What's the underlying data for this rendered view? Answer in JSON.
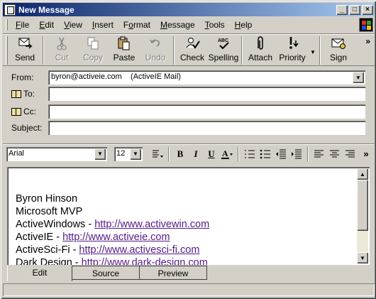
{
  "window": {
    "title": "New Message"
  },
  "menu": [
    {
      "pre": "",
      "u": "F",
      "post": "ile"
    },
    {
      "pre": "",
      "u": "E",
      "post": "dit"
    },
    {
      "pre": "",
      "u": "V",
      "post": "iew"
    },
    {
      "pre": "",
      "u": "I",
      "post": "nsert"
    },
    {
      "pre": "F",
      "u": "o",
      "post": "rmat"
    },
    {
      "pre": "",
      "u": "M",
      "post": "essage"
    },
    {
      "pre": "",
      "u": "T",
      "post": "ools"
    },
    {
      "pre": "",
      "u": "H",
      "post": "elp"
    }
  ],
  "toolbar": {
    "send": "Send",
    "cut": "Cut",
    "copy": "Copy",
    "paste": "Paste",
    "undo": "Undo",
    "check": "Check",
    "spelling": "Spelling",
    "attach": "Attach",
    "priority": "Priority",
    "sign": "Sign",
    "chevron": "»"
  },
  "header": {
    "from_label": "From:",
    "from_value": "byron@activeie.com    (ActiveIE Mail)",
    "to_label": "To:",
    "to_value": "",
    "cc_label": "Cc:",
    "cc_value": "",
    "subject_label": "Subject:",
    "subject_value": ""
  },
  "format": {
    "font": "Arial",
    "size": "12",
    "bold": "B",
    "italic": "I",
    "underline": "U",
    "chevron": "»"
  },
  "body": {
    "lines": [
      {
        "text": "Byron Hinson",
        "link": ""
      },
      {
        "text": "Microsoft MVP",
        "link": ""
      },
      {
        "text": "ActiveWindows - ",
        "link": "http://www.activewin.com"
      },
      {
        "text": "ActiveIE - ",
        "link": "http://www.activeie.com"
      },
      {
        "text": "ActiveSci-Fi - ",
        "link": "http://www.activesci-fi.com"
      },
      {
        "text": "Dark Design - ",
        "link": "http://www.dark-design.com"
      }
    ]
  },
  "tabs": {
    "edit": "Edit",
    "source": "Source",
    "preview": "Preview"
  },
  "icons": [
    "send-icon",
    "cut-icon",
    "copy-icon",
    "paste-icon",
    "undo-icon",
    "check-names-icon",
    "spelling-icon",
    "paperclip-icon",
    "priority-icon",
    "sign-icon",
    "address-book-icon"
  ]
}
